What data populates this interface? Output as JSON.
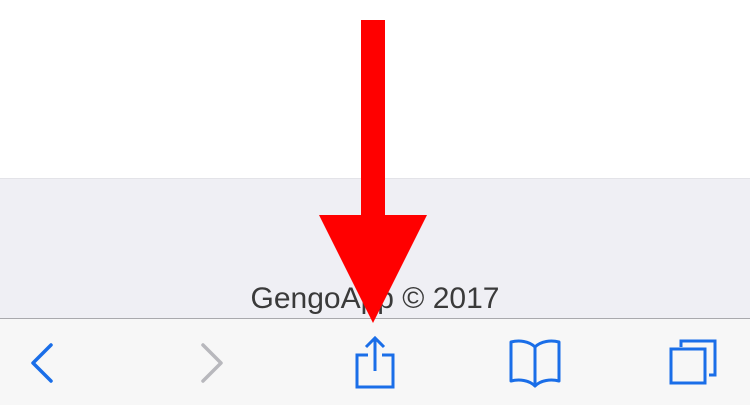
{
  "footer": {
    "copyright": "GengoApp © 2017"
  },
  "toolbar": {
    "buttons": [
      {
        "name": "back",
        "icon": "chevron-left-icon",
        "enabled": true
      },
      {
        "name": "forward",
        "icon": "chevron-right-icon",
        "enabled": false
      },
      {
        "name": "share",
        "icon": "share-icon",
        "enabled": true
      },
      {
        "name": "bookmarks",
        "icon": "book-icon",
        "enabled": true
      },
      {
        "name": "tabs",
        "icon": "tabs-icon",
        "enabled": true
      }
    ],
    "active_color": "#1a6ee8",
    "disabled_color": "#b8b8bd"
  },
  "annotation": {
    "icon": "red-arrow-down-icon",
    "color": "#ff0000"
  }
}
